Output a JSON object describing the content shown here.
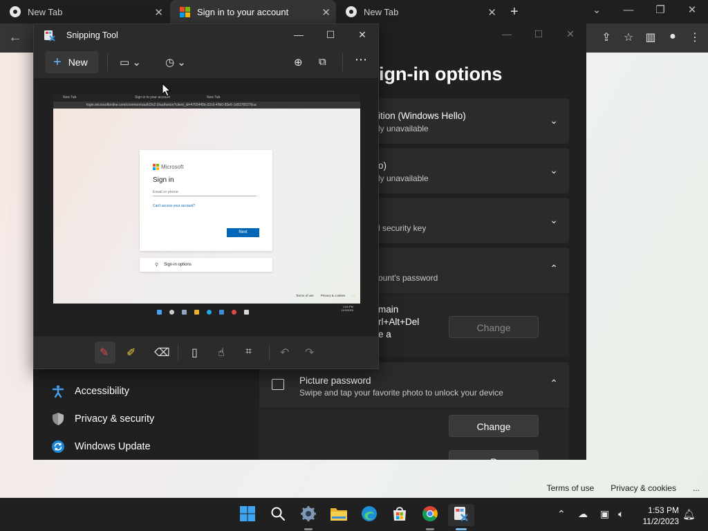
{
  "browser": {
    "tabs": [
      {
        "label": "New Tab",
        "active": false
      },
      {
        "label": "Sign in to your account",
        "active": true
      },
      {
        "label": "New Tab",
        "active": false
      }
    ],
    "footer_links": [
      "Terms of use",
      "Privacy & cookies",
      "..."
    ]
  },
  "settings": {
    "page_title": "ign-in options",
    "cards": [
      {
        "title": "ition (Windows Hello)",
        "subtitle": "ly unavailable",
        "expanded": false
      },
      {
        "title": "o)",
        "subtitle": "ly unavailable",
        "expanded": false
      },
      {
        "title": "",
        "subtitle": "l security key",
        "expanded": false
      },
      {
        "title": "",
        "subtitle": "ount's password",
        "expanded": true
      },
      {
        "title": "Picture password",
        "subtitle": "Swipe and tap your favorite photo to unlock your device",
        "expanded": true
      }
    ],
    "password_body_lines": [
      "main",
      "rl+Alt+Del",
      "e a"
    ],
    "change_label": "Change",
    "remove_label_partial": "R",
    "nav": [
      {
        "label": "Accessibility",
        "icon": "accessibility-icon"
      },
      {
        "label": "Privacy & security",
        "icon": "shield-icon"
      },
      {
        "label": "Windows Update",
        "icon": "windows-update-icon"
      }
    ]
  },
  "snipping_tool": {
    "title": "Snipping Tool",
    "new_label": "New",
    "capture": {
      "tabs": [
        "New Tab",
        "Sign in to your account",
        "New Tab"
      ],
      "url": "login.microsoftonline.com/common/oauth2/v2.0/authorize?client_id=4765445b-32c6-49b0-83e6-1d93765276ca",
      "brand": "Microsoft",
      "heading": "Sign in",
      "email_placeholder": "Email or phone",
      "cant_access": "Can't access your account?",
      "next": "Next",
      "signin_options": "Sign-in options",
      "footer": [
        "Terms of use",
        "Privacy & cookies",
        "..."
      ],
      "clock_time": "1:53 PM",
      "clock_date": "11/2/2023"
    }
  },
  "taskbar": {
    "time": "1:53 PM",
    "date": "11/2/2023"
  },
  "colors": {
    "accent": "#76b9ed",
    "ms_red": "#f25022",
    "ms_green": "#7fba00",
    "ms_blue": "#00a4ef",
    "ms_yellow": "#ffb900",
    "ms_link": "#0067b8"
  }
}
